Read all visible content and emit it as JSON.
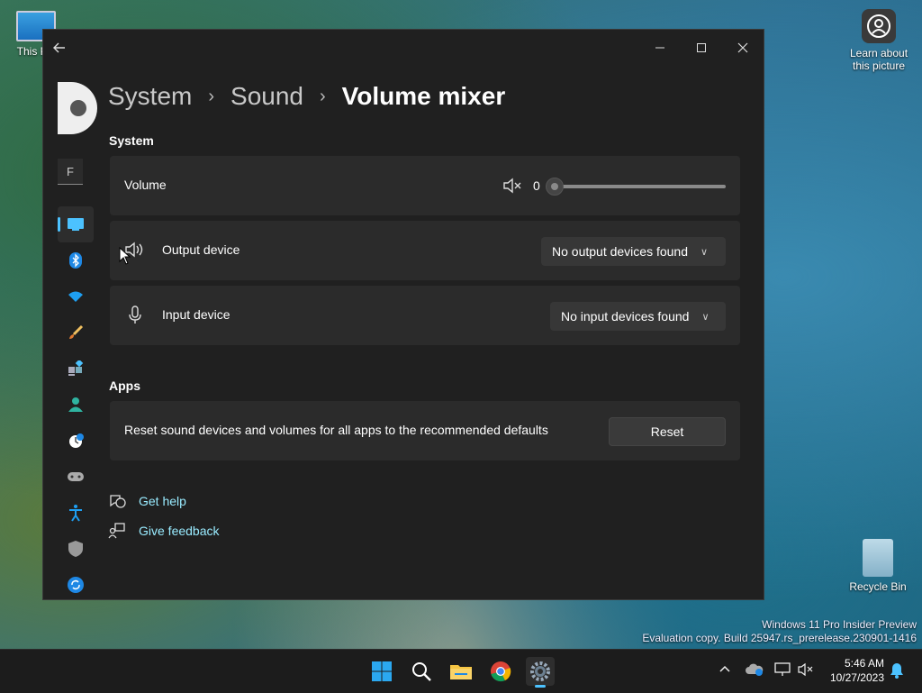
{
  "desktop": {
    "this_pc_label": "This PC",
    "learn_label": "Learn about this picture",
    "recycle_label": "Recycle Bin",
    "watermark_line1": "Windows 11 Pro Insider Preview",
    "watermark_line2": "Evaluation copy. Build 25947.rs_prerelease.230901-1416"
  },
  "window": {
    "search_placeholder": "F",
    "breadcrumb": [
      "System",
      "Sound",
      "Volume mixer"
    ],
    "breadcrumb_separator": "›",
    "nav_icons": [
      "system-icon",
      "bluetooth-icon",
      "wifi-icon",
      "brush-icon",
      "apps-icon",
      "accounts-icon",
      "time-icon",
      "gaming-icon",
      "accessibility-icon",
      "shield-icon",
      "update-icon"
    ],
    "system_section": {
      "title": "System",
      "volume_label": "Volume",
      "volume_value": "0",
      "volume_level": 0,
      "output_label": "Output device",
      "output_value": "No output devices found",
      "input_label": "Input device",
      "input_value": "No input devices found"
    },
    "apps_section": {
      "title": "Apps",
      "reset_text": "Reset sound devices and volumes for all apps to the recommended defaults",
      "reset_button": "Reset"
    },
    "links": {
      "help": "Get help",
      "feedback": "Give feedback"
    }
  },
  "taskbar": {
    "time": "5:46 AM",
    "date": "10/27/2023",
    "icons": [
      "start-icon",
      "search-icon",
      "file-explorer-icon",
      "chrome-icon",
      "settings-icon"
    ]
  },
  "colors": {
    "accent": "#4cc2ff",
    "link": "#99ebff",
    "card": "#2b2b2b",
    "window": "#202020"
  }
}
